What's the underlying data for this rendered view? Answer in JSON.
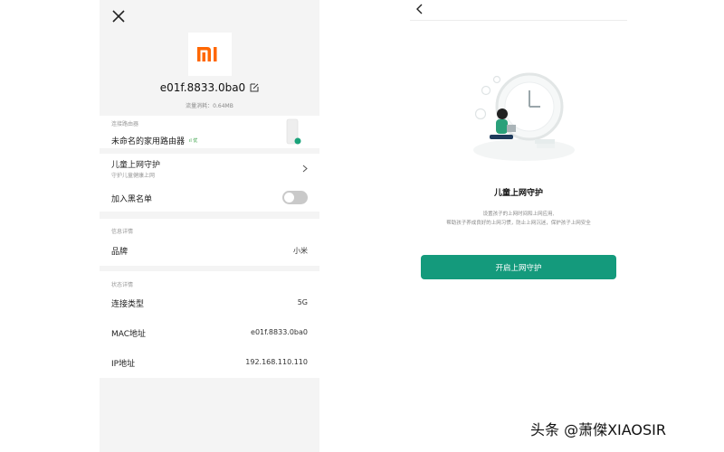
{
  "left_panel": {
    "device_name": "e01f.8833.0ba0",
    "traffic": "流量消耗：0.64MB",
    "router": {
      "section_label": "连接路由器",
      "name": "未命名的家用路由器",
      "signal_tag": "ıl 优"
    },
    "child_protection": {
      "label": "儿童上网守护",
      "subtitle": "守护儿童健康上网"
    },
    "blacklist": {
      "label": "加入黑名单"
    },
    "info": {
      "section_label": "信息详情",
      "brand_label": "品牌",
      "brand_value": "小米"
    },
    "status": {
      "section_label": "状态详情",
      "connection_label": "连接类型",
      "connection_value": "5G",
      "mac_label": "MAC地址",
      "mac_value": "e01f.8833.0ba0",
      "ip_label": "IP地址",
      "ip_value": "192.168.110.110"
    },
    "icons": [
      "close-icon",
      "mi-logo",
      "edit-icon",
      "router-icon",
      "chevron-right-icon"
    ],
    "colors": {
      "brand": "#ff6700",
      "toggle_off": "#c9c9c9"
    }
  },
  "right_panel": {
    "title": "儿童上网守护",
    "description_line1": "设置孩子的上网时间和上网应用,",
    "description_line2": "帮助孩子养成良好的上网习惯，防止上网沉迷，保护孩子上网安全",
    "enable_button": "开启上网守护",
    "icons": [
      "back-icon",
      "clock-illustration"
    ],
    "colors": {
      "accent": "#149a7c"
    }
  },
  "watermark": "头条 @萧傑XIAOSIR"
}
